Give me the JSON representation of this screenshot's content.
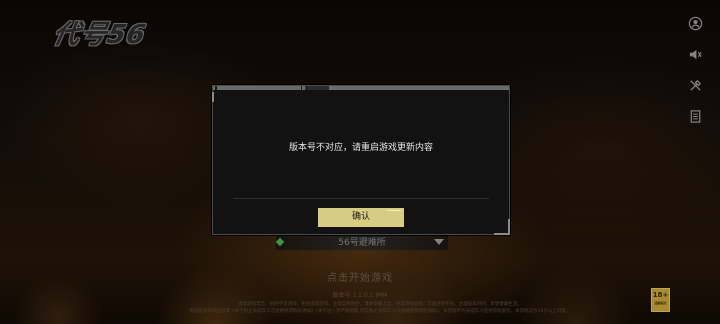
{
  "game": {
    "logo": "代号56"
  },
  "side_menu": {
    "icons": [
      "user-icon",
      "sound-icon",
      "tools-icon",
      "notice-icon"
    ]
  },
  "server": {
    "name": "56号避难所"
  },
  "start": {
    "label": "点击开始游戏"
  },
  "version": {
    "text": "版本号 1.1.0.1 IMM"
  },
  "footer": {
    "line1": "健康游戏忠告：抵制不良游戏，拒绝盗版游戏。注意自我保护，谨防受骗上当。适度游戏益脑，沉迷游戏伤身。合理安排时间，享受健康生活。",
    "line2": "根据国家新闻出版署《关于防止未成年人沉迷网络游戏的通知》《关于进一步严格管理 切实防止未成年人沉迷网络游戏的通知》，本游戏不为未成年人提供游戏服务。本游戏适合18岁以上玩家。"
  },
  "age_rating": {
    "label": "18+",
    "sub": "适龄提示"
  },
  "dialog": {
    "message": "版本号不对应，请重启游戏更新内容",
    "confirm_label": "确认"
  },
  "colors": {
    "confirm_bg": "#d8cc84",
    "server_diamond": "#4fae4f"
  }
}
